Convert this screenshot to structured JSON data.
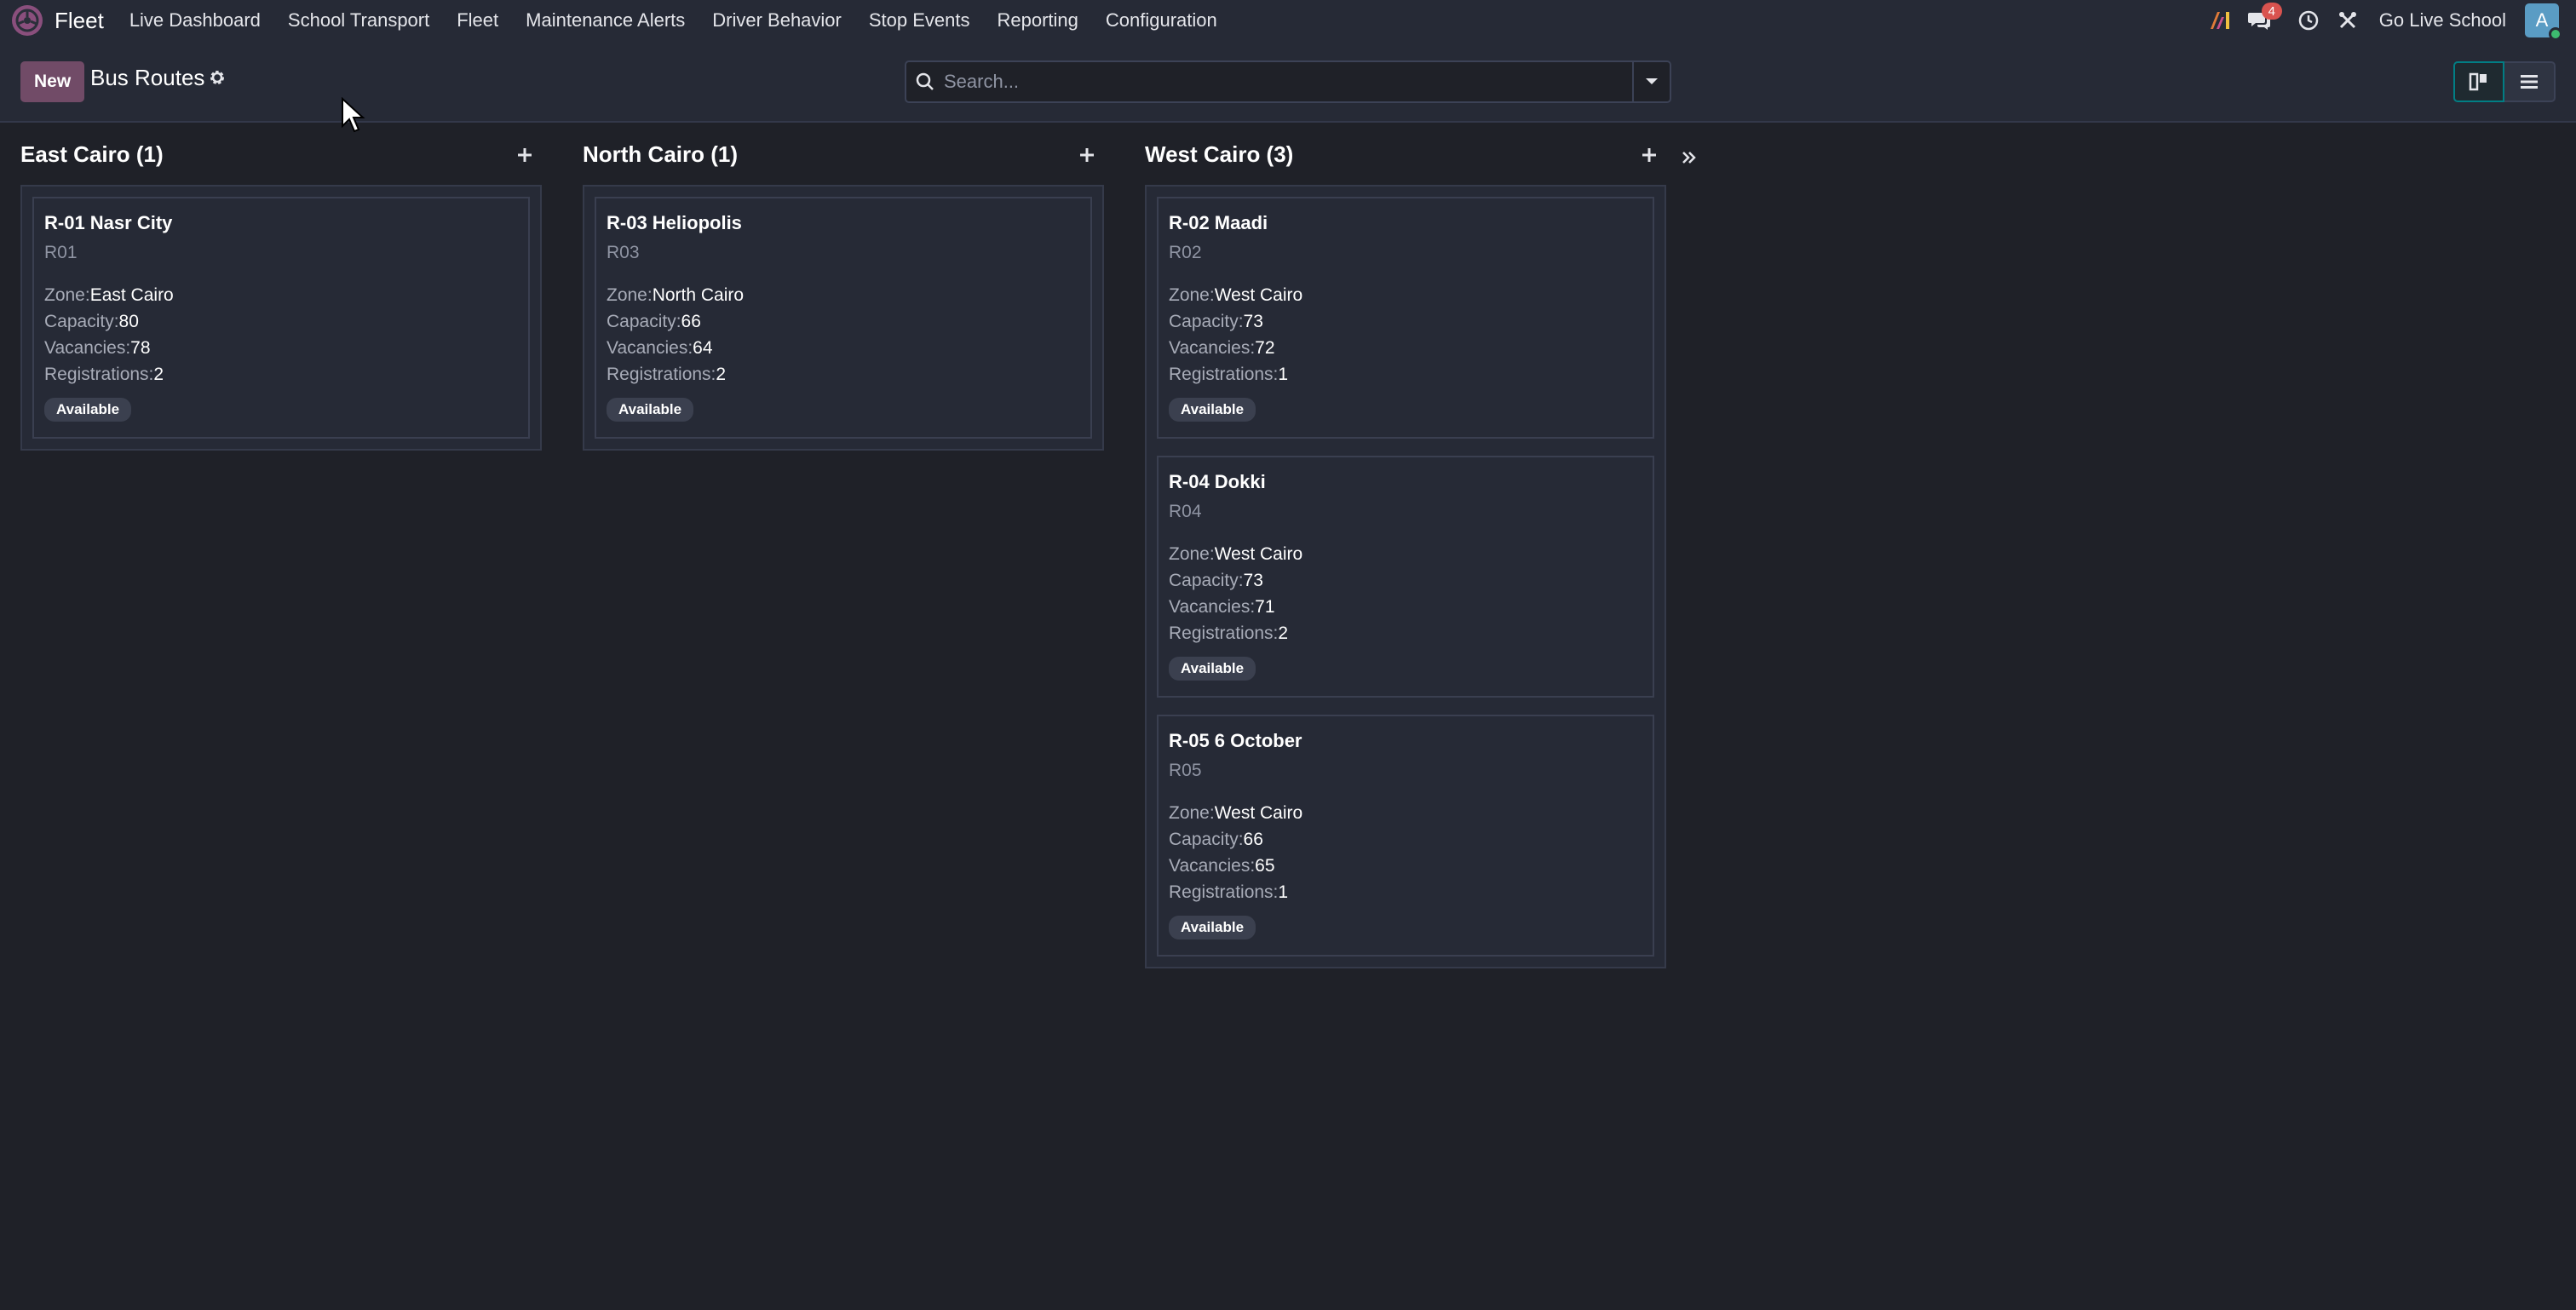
{
  "navbar": {
    "app_name": "Fleet",
    "menu": [
      {
        "label": "Live Dashboard"
      },
      {
        "label": "School Transport"
      },
      {
        "label": "Fleet"
      },
      {
        "label": "Maintenance Alerts"
      },
      {
        "label": "Driver Behavior"
      },
      {
        "label": "Stop Events"
      },
      {
        "label": "Reporting"
      },
      {
        "label": "Configuration"
      }
    ],
    "message_count": "4",
    "company": "Go Live School",
    "avatar_letter": "A"
  },
  "control": {
    "new_label": "New",
    "title": "Bus Routes",
    "search_placeholder": "Search..."
  },
  "kanban": {
    "columns": [
      {
        "title": "East Cairo (1)",
        "cards": [
          {
            "name": "R-01 Nasr City",
            "code": "R01",
            "zone": "East Cairo",
            "capacity": "80",
            "vacancies": "78",
            "registrations": "2",
            "status": "Available"
          }
        ]
      },
      {
        "title": "North Cairo (1)",
        "cards": [
          {
            "name": "R-03 Heliopolis",
            "code": "R03",
            "zone": "North Cairo",
            "capacity": "66",
            "vacancies": "64",
            "registrations": "2",
            "status": "Available"
          }
        ]
      },
      {
        "title": "West Cairo (3)",
        "cards": [
          {
            "name": "R-02 Maadi",
            "code": "R02",
            "zone": "West Cairo",
            "capacity": "73",
            "vacancies": "72",
            "registrations": "1",
            "status": "Available"
          },
          {
            "name": "R-04 Dokki",
            "code": "R04",
            "zone": "West Cairo",
            "capacity": "73",
            "vacancies": "71",
            "registrations": "2",
            "status": "Available"
          },
          {
            "name": "R-05 6 October",
            "code": "R05",
            "zone": "West Cairo",
            "capacity": "66",
            "vacancies": "65",
            "registrations": "1",
            "status": "Available"
          }
        ]
      }
    ]
  },
  "labels": {
    "zone": "Zone:",
    "capacity": "Capacity:",
    "vacancies": "Vacancies:",
    "registrations": "Registrations:"
  },
  "colors": {
    "background": "#1f2128",
    "navbar": "#262a36",
    "brand": "#714b67",
    "accent": "#017e84"
  }
}
